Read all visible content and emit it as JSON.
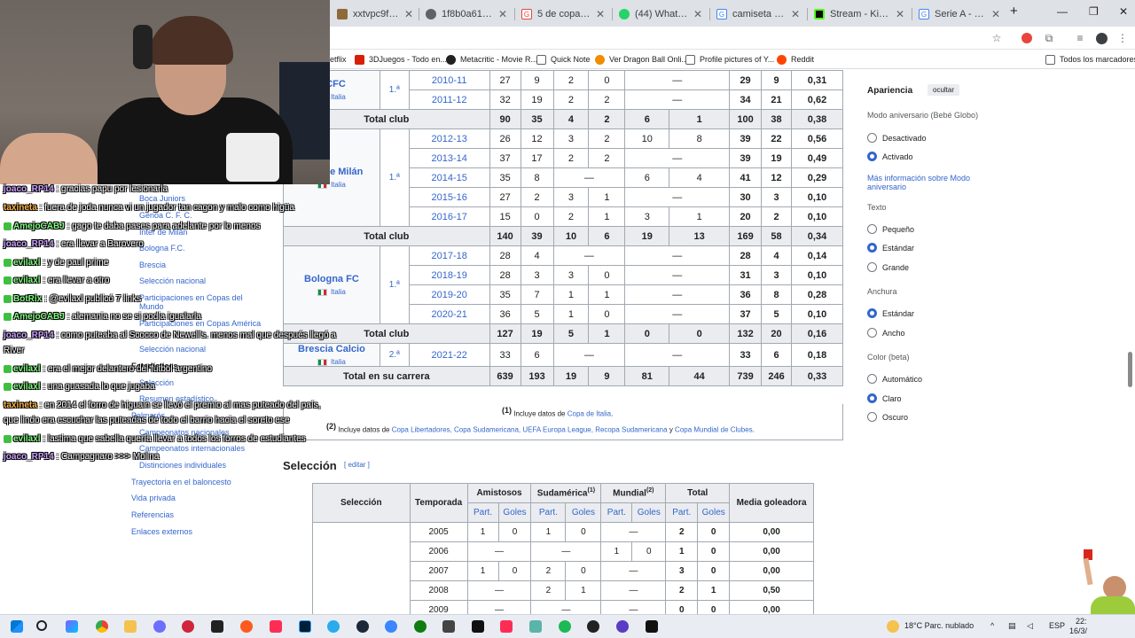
{
  "browser": {
    "tabs": [
      {
        "title": "xxtvpc9ft6asag7s",
        "color": "#8e6a3a"
      },
      {
        "title": "1f8b0a613b0bc4",
        "color": "#5f6368"
      },
      {
        "title": "5 de copas tarot",
        "color": "#e8453c"
      },
      {
        "title": "(44) WhatsApp",
        "color": "#25d366"
      },
      {
        "title": "camiseta wande",
        "color": "#4285f4"
      },
      {
        "title": "Stream - Kick Da",
        "color": "#53fc18"
      },
      {
        "title": "Serie A - Buscar",
        "color": "#4285f4"
      }
    ],
    "new_tab": "+",
    "bookmarks": [
      {
        "label": "etflix",
        "color": "#e50914"
      },
      {
        "label": "3DJuegos - Todo en...",
        "color": "#d81e05"
      },
      {
        "label": "Metacritic - Movie R...",
        "color": "#222222"
      },
      {
        "label": "Quick Note",
        "color": "#5f6368"
      },
      {
        "label": "Ver Dragon Ball Onli...",
        "color": "#f28c00"
      },
      {
        "label": "Profile pictures of Y...",
        "color": "#5f6368"
      },
      {
        "label": "Reddit",
        "color": "#ff4500"
      }
    ],
    "all_bookmarks": "Todos los marcadores"
  },
  "stats": {
    "clubs": [
      {
        "name": "a CFC",
        "country": "Italia",
        "level": "1.ª",
        "rows": [
          [
            "2010-11",
            "27",
            "9",
            "2",
            "0",
            "—",
            "29",
            "9",
            "0,31"
          ],
          [
            "2011-12",
            "32",
            "19",
            "2",
            "2",
            "—",
            "34",
            "21",
            "0,62"
          ]
        ],
        "total": [
          "Total club",
          "90",
          "35",
          "4",
          "2",
          "6",
          "1",
          "100",
          "38",
          "0,38"
        ]
      },
      {
        "name": "Inter de Milán",
        "country": "Italia",
        "level": "1.ª",
        "rows": [
          [
            "2012-13",
            "26",
            "12",
            "3",
            "2",
            "10",
            "8",
            "39",
            "22",
            "0,56"
          ],
          [
            "2013-14",
            "37",
            "17",
            "2",
            "2",
            "—",
            "39",
            "19",
            "0,49"
          ],
          [
            "2014-15",
            "35",
            "8",
            "—",
            "6",
            "4",
            "41",
            "12",
            "0,29"
          ],
          [
            "2015-16",
            "27",
            "2",
            "3",
            "1",
            "—",
            "30",
            "3",
            "0,10"
          ],
          [
            "2016-17",
            "15",
            "0",
            "2",
            "1",
            "3",
            "1",
            "20",
            "2",
            "0,10"
          ]
        ],
        "total": [
          "Total club",
          "140",
          "39",
          "10",
          "6",
          "19",
          "13",
          "169",
          "58",
          "0,34"
        ]
      },
      {
        "name": "Bologna FC",
        "country": "Italia",
        "level": "1.ª",
        "rows": [
          [
            "2017-18",
            "28",
            "4",
            "—",
            "—",
            "28",
            "4",
            "0,14"
          ],
          [
            "2018-19",
            "28",
            "3",
            "3",
            "0",
            "—",
            "31",
            "3",
            "0,10"
          ],
          [
            "2019-20",
            "35",
            "7",
            "1",
            "1",
            "—",
            "36",
            "8",
            "0,28"
          ],
          [
            "2020-21",
            "36",
            "5",
            "1",
            "0",
            "—",
            "37",
            "5",
            "0,10"
          ]
        ],
        "total": [
          "Total club",
          "127",
          "19",
          "5",
          "1",
          "0",
          "0",
          "132",
          "20",
          "0,16"
        ]
      },
      {
        "name": "Brescia Calcio",
        "country": "Italia",
        "level": "2.ª",
        "rows": [
          [
            "2021-22",
            "33",
            "6",
            "—",
            "—",
            "33",
            "6",
            "0,18"
          ]
        ]
      }
    ],
    "career": [
      "Total en su carrera",
      "639",
      "193",
      "19",
      "9",
      "81",
      "44",
      "739",
      "246",
      "0,33"
    ],
    "note1": {
      "num": "(1)",
      "text": " Incluye datos de ",
      "link": "Copa de Italia",
      "end": "."
    },
    "note2": {
      "num": "(2)",
      "text": " Incluye datos de ",
      "links": "Copa Libertadores, Copa Sudamericana, UEFA Europa League, Recopa Sudamericana",
      "and": " y ",
      "last": "Copa Mundial de Clubes",
      "end": "."
    }
  },
  "appearance": {
    "title": "Apariencia",
    "hide": "ocultar",
    "anniv_heading": "Modo aniversario (Bebé Globo)",
    "anniv_off": "Desactivado",
    "anniv_on": "Activado",
    "more_info": "Más información sobre Modo aniversario",
    "text_heading": "Texto",
    "text_small": "Pequeño",
    "text_std": "Estándar",
    "text_large": "Grande",
    "width_heading": "Anchura",
    "width_std": "Estándar",
    "width_wide": "Ancho",
    "color_heading": "Color (beta)",
    "color_auto": "Automático",
    "color_light": "Claro",
    "color_dark": "Oscuro"
  },
  "seleccion": {
    "heading": "Selección",
    "edit": "[ editar ]",
    "col_sel": "Selección",
    "col_temp": "Temporada",
    "col_amist": "Amistosos",
    "col_sud": "Sudamérica",
    "sup1": "(1)",
    "col_mund": "Mundial",
    "sup2": "(2)",
    "col_total": "Total",
    "col_media": "Media goleadora",
    "part": "Part.",
    "goles": "Goles",
    "rows": [
      [
        "2005",
        "1",
        "0",
        "1",
        "0",
        "—",
        "2",
        "0",
        "0,00"
      ],
      [
        "2006",
        "—",
        "—",
        "1",
        "0",
        "1",
        "0",
        "0,00"
      ],
      [
        "2007",
        "1",
        "0",
        "2",
        "0",
        "—",
        "3",
        "0",
        "0,00"
      ],
      [
        "2008",
        "—",
        "2",
        "1",
        "—",
        "2",
        "1",
        "0,50"
      ],
      [
        "2009",
        "—",
        "—",
        "—",
        "0",
        "0",
        "0,00"
      ]
    ]
  },
  "toc": {
    "items": [
      "Boca Juniors",
      "Genoa C. F. C.",
      "Inter de Milán",
      "Bologna F.C.",
      "Brescia",
      "Selección nacional",
      "Participaciones en Copas del Mundo",
      "Participaciones en Copas América",
      "Selección nacional",
      "Estadísticas",
      "Selección",
      "Resumen estadístico",
      "Palmarés",
      "Campeonatos nacionales",
      "Campeonatos internacionales",
      "Distinciones individuales",
      "Trayectoria en el baloncesto",
      "Vida privada",
      "Referencias",
      "Enlaces externos"
    ]
  },
  "chat": [
    {
      "user": "joaco_RP14",
      "msg": " : gracias papu por lesionarla",
      "color": "#c9a0ff"
    },
    {
      "user": "taxineta",
      "msg": " : fuera de joda nunca vi un jugador tan cagon y malo como higüa",
      "color": "#ffb347"
    },
    {
      "user": "AmejoCABJ",
      "msg": " : gago te daba pases para adelante por lo menos",
      "color": "#7fff7f"
    },
    {
      "user": "joaco_RP14",
      "msg": " : era llevar a Barovero",
      "color": "#c9a0ff"
    },
    {
      "user": "evilaxl",
      "msg": " : y de paul prime",
      "color": "#7fff7f"
    },
    {
      "user": "evilaxl",
      "msg": " : era llevar a otro",
      "color": "#7fff7f"
    },
    {
      "user": "BotRix",
      "msg": " : @evilaxl publicó 7 links",
      "color": "#7fff7f"
    },
    {
      "user": "AmejoCABJ",
      "msg": " : alemania no se si podia igualarla",
      "color": "#7fff7f"
    },
    {
      "user": "joaco_RP14",
      "msg": " : como puteaba al Scocco de Newell's. menos mal que después llegó a",
      "color": "#c9a0ff"
    },
    {
      "user": "",
      "msg": "River",
      "color": "#ffffff"
    },
    {
      "user": "evilaxl",
      "msg": " : era el mejor delantero del futbol argentino",
      "color": "#7fff7f"
    },
    {
      "user": "evilaxl",
      "msg": " : una guasada lo que jugaba",
      "color": "#7fff7f"
    },
    {
      "user": "taxineta",
      "msg": " : en 2014 el forro de higuain se llevó el premio al mas puteado del país,",
      "color": "#ffb347"
    },
    {
      "user": "",
      "msg": "que lindo era escuchar las puteadas de todo el barrio hacia el soreto ese",
      "color": "#ffffff"
    },
    {
      "user": "evilaxl",
      "msg": " : lastima que sabella quería llevar a todos los forros de estudiantes",
      "color": "#7fff7f"
    },
    {
      "user": "joaco_RP14",
      "msg": " : Campagnaro >>> Molina",
      "color": "#c9a0ff"
    }
  ],
  "taskbar": {
    "weather": "18°C  Parc. nublado",
    "lang": "ESP",
    "time": "22:",
    "date": "16/3/"
  }
}
